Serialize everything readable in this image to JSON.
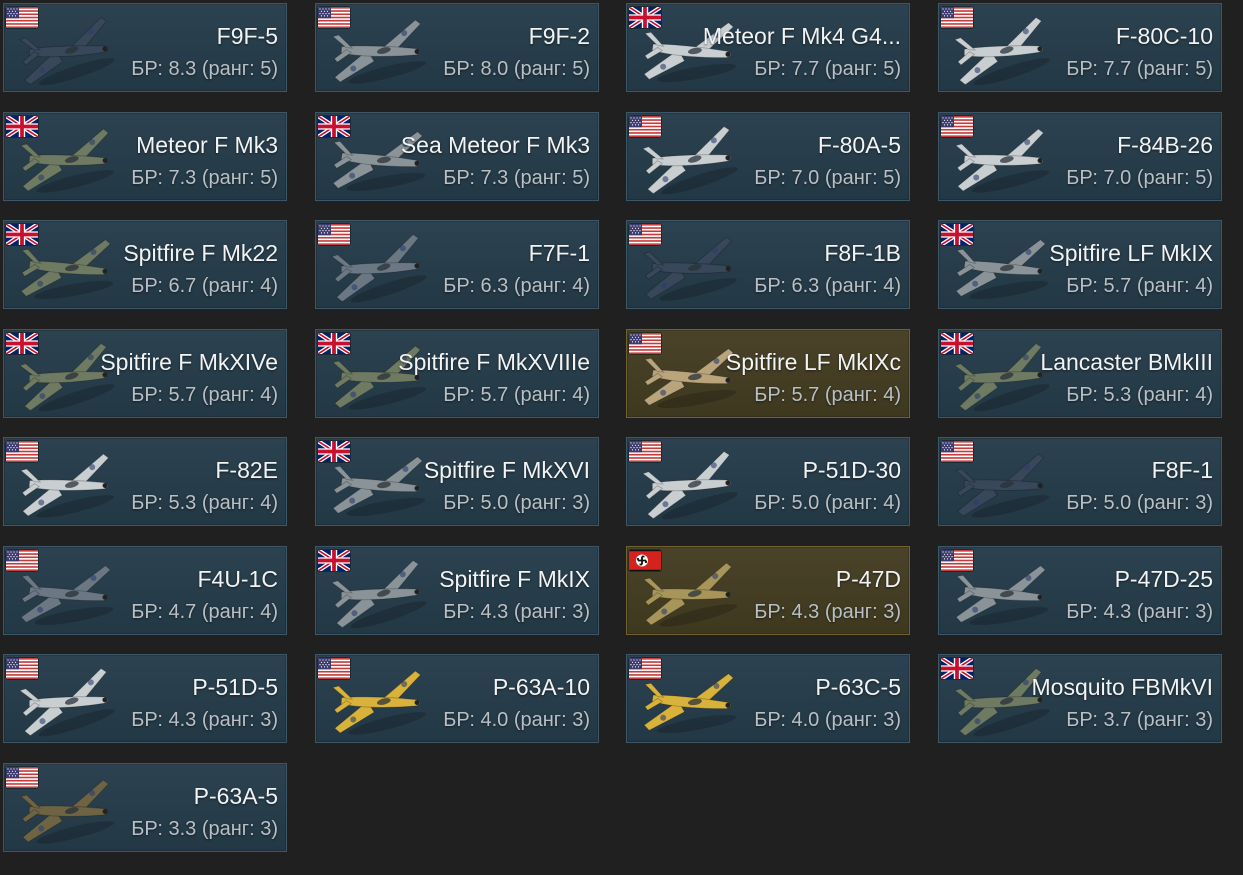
{
  "br_prefix": "БР:",
  "rank_prefix": "ранг:",
  "vehicles": [
    {
      "name": "F9F-5",
      "br": "8.3",
      "rank": 5,
      "flag": "usa-flag-icon",
      "plane": "dark-navy",
      "highlight": false
    },
    {
      "name": "F9F-2",
      "br": "8.0",
      "rank": 5,
      "flag": "usa-flag-icon",
      "plane": "grey",
      "highlight": false
    },
    {
      "name": "Meteor F Mk4 G4...",
      "br": "7.7",
      "rank": 5,
      "flag": "uk-flag-icon",
      "plane": "silver",
      "highlight": false
    },
    {
      "name": "F-80C-10",
      "br": "7.7",
      "rank": 5,
      "flag": "usa-flag-icon",
      "plane": "silver",
      "highlight": false
    },
    {
      "name": "Meteor F Mk3",
      "br": "7.3",
      "rank": 5,
      "flag": "uk-flag-icon",
      "plane": "green-camo",
      "highlight": false
    },
    {
      "name": "Sea Meteor F Mk3",
      "br": "7.3",
      "rank": 5,
      "flag": "uk-flag-icon",
      "plane": "grey",
      "highlight": false
    },
    {
      "name": "F-80A-5",
      "br": "7.0",
      "rank": 5,
      "flag": "usa-flag-icon",
      "plane": "silver",
      "highlight": false
    },
    {
      "name": "F-84B-26",
      "br": "7.0",
      "rank": 5,
      "flag": "usa-flag-icon",
      "plane": "silver",
      "highlight": false
    },
    {
      "name": "Spitfire F Mk22",
      "br": "6.7",
      "rank": 4,
      "flag": "uk-flag-icon",
      "plane": "green-camo",
      "highlight": false
    },
    {
      "name": "F7F-1",
      "br": "6.3",
      "rank": 4,
      "flag": "usa-flag-icon",
      "plane": "blue-grey",
      "highlight": false
    },
    {
      "name": "F8F-1B",
      "br": "6.3",
      "rank": 4,
      "flag": "usa-flag-icon",
      "plane": "dark-navy",
      "highlight": false
    },
    {
      "name": "Spitfire LF MkIX",
      "br": "5.7",
      "rank": 4,
      "flag": "uk-flag-icon",
      "plane": "grey",
      "highlight": false
    },
    {
      "name": "Spitfire F MkXIVe",
      "br": "5.7",
      "rank": 4,
      "flag": "uk-flag-icon",
      "plane": "green-camo",
      "highlight": false
    },
    {
      "name": "Spitfire F MkXVIIIe",
      "br": "5.7",
      "rank": 4,
      "flag": "uk-flag-icon",
      "plane": "green-camo",
      "highlight": false
    },
    {
      "name": "Spitfire LF MkIXc",
      "br": "5.7",
      "rank": 4,
      "flag": "usa-flag-icon",
      "plane": "desert",
      "highlight": true
    },
    {
      "name": "Lancaster BMkIII",
      "br": "5.3",
      "rank": 4,
      "flag": "uk-flag-icon",
      "plane": "green-camo",
      "highlight": false
    },
    {
      "name": "F-82E",
      "br": "5.3",
      "rank": 4,
      "flag": "usa-flag-icon",
      "plane": "silver",
      "highlight": false
    },
    {
      "name": "Spitfire F MkXVI",
      "br": "5.0",
      "rank": 3,
      "flag": "uk-flag-icon",
      "plane": "grey",
      "highlight": false
    },
    {
      "name": "P-51D-30",
      "br": "5.0",
      "rank": 4,
      "flag": "usa-flag-icon",
      "plane": "silver",
      "highlight": false
    },
    {
      "name": "F8F-1",
      "br": "5.0",
      "rank": 3,
      "flag": "usa-flag-icon",
      "plane": "dark-navy",
      "highlight": false
    },
    {
      "name": "F4U-1C",
      "br": "4.7",
      "rank": 4,
      "flag": "usa-flag-icon",
      "plane": "blue-grey",
      "highlight": false
    },
    {
      "name": "Spitfire F MkIX",
      "br": "4.3",
      "rank": 3,
      "flag": "uk-flag-icon",
      "plane": "grey",
      "highlight": false
    },
    {
      "name": "P-47D",
      "br": "4.3",
      "rank": 3,
      "flag": "germany-flag-icon",
      "plane": "olive-yellow",
      "highlight": true
    },
    {
      "name": "P-47D-25",
      "br": "4.3",
      "rank": 3,
      "flag": "usa-flag-icon",
      "plane": "grey",
      "highlight": false
    },
    {
      "name": "P-51D-5",
      "br": "4.3",
      "rank": 3,
      "flag": "usa-flag-icon",
      "plane": "silver",
      "highlight": false
    },
    {
      "name": "P-63A-10",
      "br": "4.0",
      "rank": 3,
      "flag": "usa-flag-icon",
      "plane": "yellow",
      "highlight": false
    },
    {
      "name": "P-63C-5",
      "br": "4.0",
      "rank": 3,
      "flag": "usa-flag-icon",
      "plane": "yellow",
      "highlight": false
    },
    {
      "name": "Mosquito FBMkVI",
      "br": "3.7",
      "rank": 3,
      "flag": "uk-flag-icon",
      "plane": "green-camo",
      "highlight": false
    },
    {
      "name": "P-63A-5",
      "br": "3.3",
      "rank": 3,
      "flag": "usa-flag-icon",
      "plane": "olive",
      "highlight": false
    }
  ],
  "plane_colors": {
    "dark-navy": "#38475a",
    "grey": "#8a9398",
    "silver": "#c9ced1",
    "green-camo": "#6f7a62",
    "blue-grey": "#6b7884",
    "desert": "#b9a47c",
    "olive-yellow": "#a7955a",
    "yellow": "#d8b23b",
    "olive": "#6e6444"
  }
}
